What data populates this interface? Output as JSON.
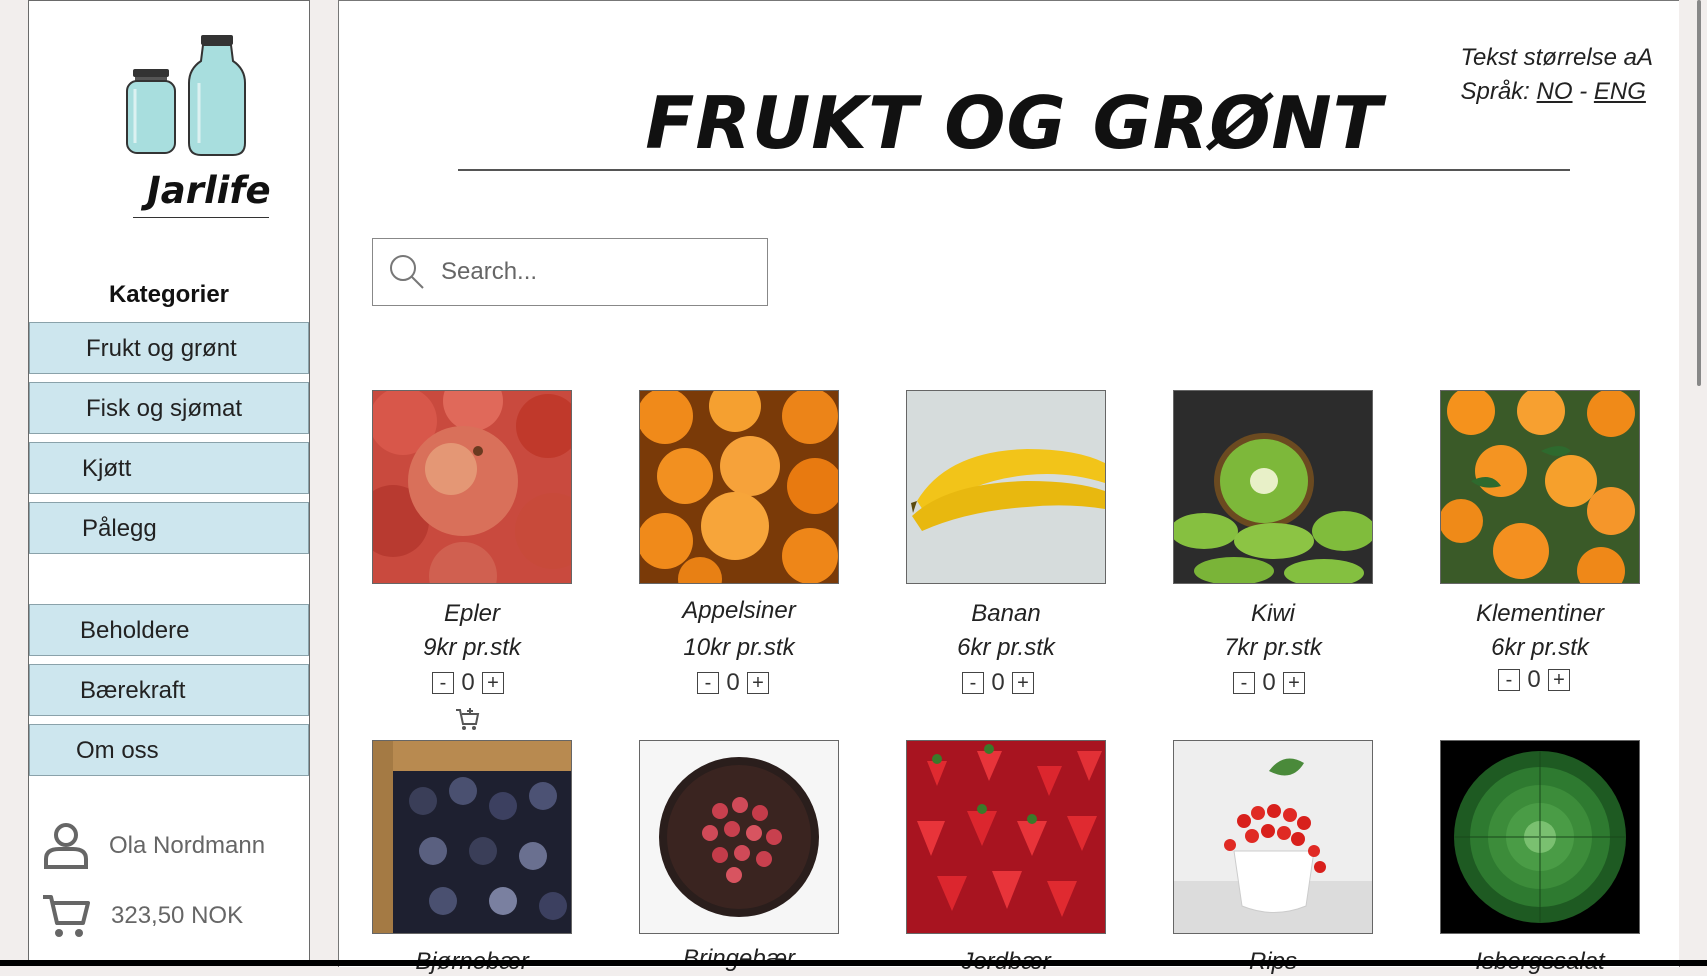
{
  "app": {
    "brand": "Jarlife"
  },
  "sidebar": {
    "categories_title": "Kategorier",
    "items": [
      {
        "label": "Frukt og grønt"
      },
      {
        "label": "Fisk og sjømat"
      },
      {
        "label": "Kjøtt"
      },
      {
        "label": "Pålegg"
      },
      {
        "label": "Beholdere"
      },
      {
        "label": "Bærekraft"
      },
      {
        "label": "Om oss"
      }
    ],
    "user": {
      "name": "Ola Nordmann",
      "icon": "user-icon"
    },
    "cart": {
      "total": "323,50 NOK",
      "icon": "cart-icon"
    }
  },
  "header": {
    "title": "FRUKT OG GRØNT",
    "text_size_label": "Tekst størrelse aA",
    "language_label": "Språk:",
    "lang_no": "NO",
    "lang_sep": "-",
    "lang_eng": "ENG"
  },
  "search": {
    "placeholder": "Search..."
  },
  "qty_controls": {
    "minus": "-",
    "plus": "+"
  },
  "products": [
    {
      "name": "Epler",
      "price": "9kr pr.stk",
      "qty": "0"
    },
    {
      "name": "Appelsiner",
      "price": "10kr pr.stk",
      "qty": "0"
    },
    {
      "name": "Banan",
      "price": "6kr pr.stk",
      "qty": "0"
    },
    {
      "name": "Kiwi",
      "price": "7kr pr.stk",
      "qty": "0"
    },
    {
      "name": "Klementiner",
      "price": "6kr pr.stk",
      "qty": "0"
    },
    {
      "name": "Bjørnebær"
    },
    {
      "name": "Bringebær"
    },
    {
      "name": "Jordbær"
    },
    {
      "name": "Rips"
    },
    {
      "name": "Isbergssalat"
    }
  ],
  "colors": {
    "nav_bg": "#cde6ee",
    "jar": "#a8dede"
  }
}
